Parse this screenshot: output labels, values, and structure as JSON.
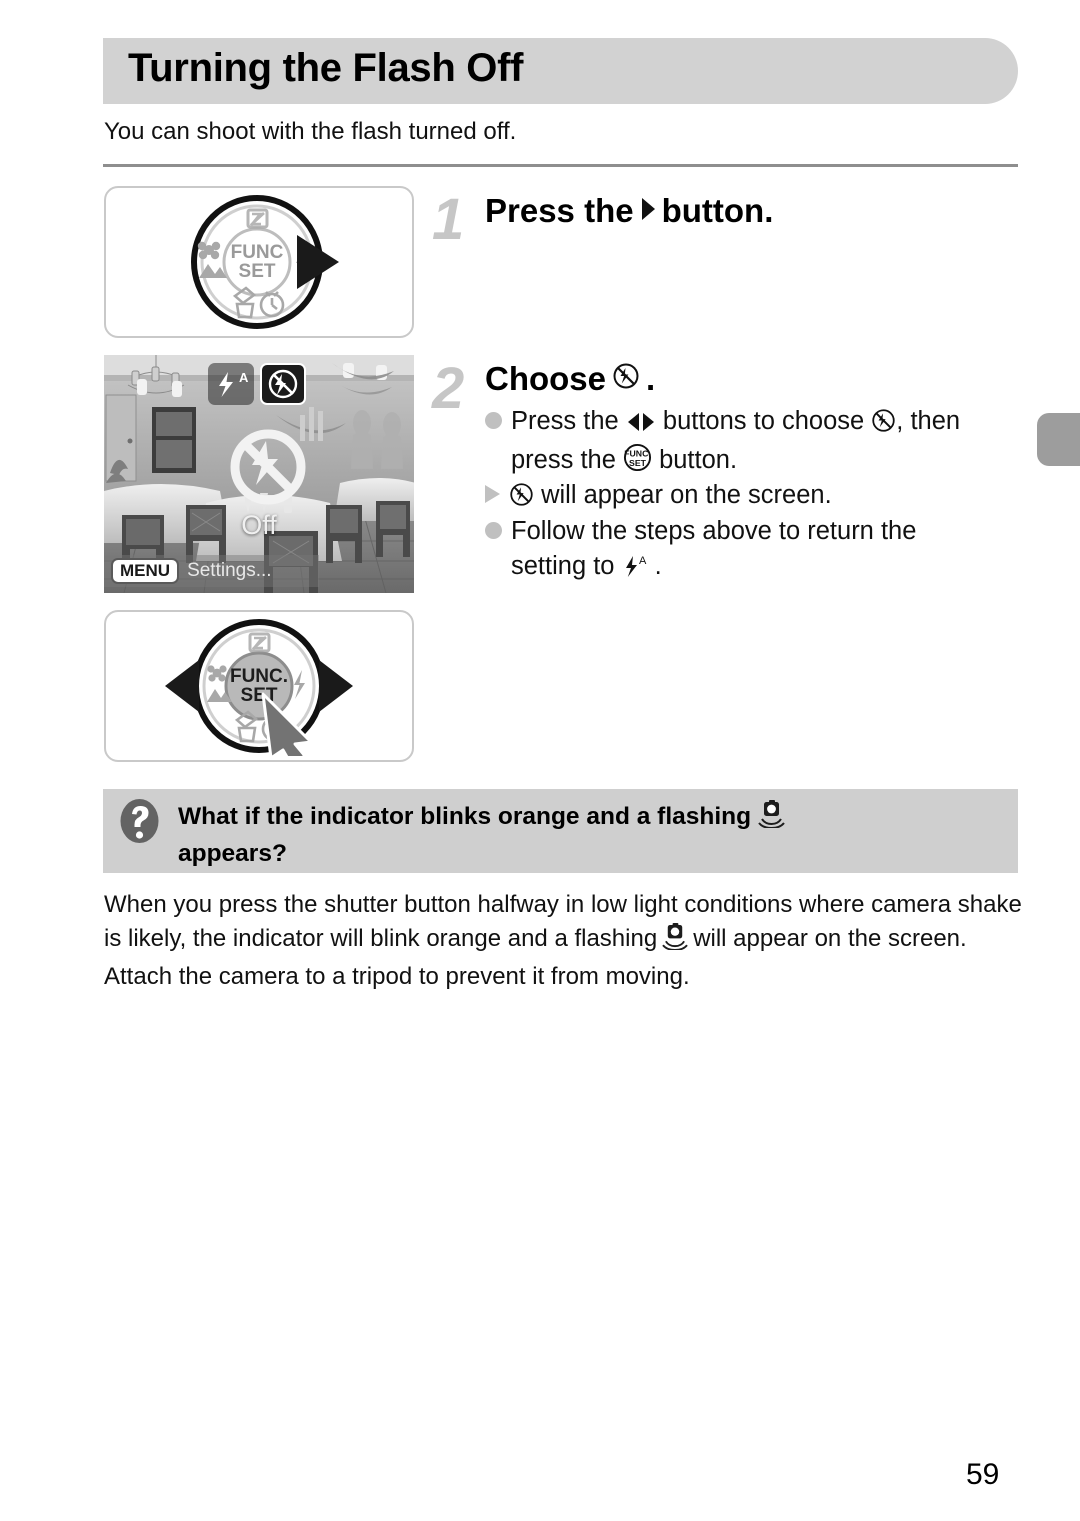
{
  "page": {
    "title": "Turning the Flash Off",
    "intro": "You can shoot with the flash turned off.",
    "number": "59"
  },
  "steps": [
    {
      "number": "1",
      "title_before": "Press the",
      "title_icon": "right-arrow-button-icon",
      "title_after": "button.",
      "figure": {
        "type": "control-dial",
        "center_label_line1": "FUNC",
        "center_label_line2": "SET",
        "highlight": "right-arrow",
        "icons": {
          "top": "exposure-compensation-icon",
          "left": "macro-landscape-icon",
          "right": "flash-icon",
          "bottom": "delete-timer-icon"
        }
      }
    },
    {
      "number": "2",
      "title_before": "Choose",
      "title_icon": "flash-off-icon",
      "title_after": ".",
      "bullets": [
        {
          "marker": "dot",
          "segments": [
            {
              "text": "Press the "
            },
            {
              "icon": "left-right-arrows-icon"
            },
            {
              "text": " buttons to choose "
            },
            {
              "icon": "flash-off-icon"
            },
            {
              "text": ", then press the "
            },
            {
              "icon": "func-set-button-icon"
            },
            {
              "text": " button."
            }
          ]
        },
        {
          "marker": "triangle",
          "segments": [
            {
              "icon": "flash-off-icon"
            },
            {
              "text": " will appear on the screen."
            }
          ]
        },
        {
          "marker": "dot",
          "segments": [
            {
              "text": "Follow the steps above to return the setting to "
            },
            {
              "icon": "flash-auto-icon"
            },
            {
              "text": " ."
            }
          ]
        }
      ],
      "figure": {
        "type": "control-dial-pressed",
        "center_label_line1": "FUNC",
        "center_label_line2": "SET",
        "highlight": "left-right-arrows-and-center-press"
      }
    }
  ],
  "lcd_screen": {
    "scene_description": "restaurant-interior-photo",
    "flash_options": [
      {
        "name": "flash-auto",
        "label": "",
        "selected": false
      },
      {
        "name": "flash-off",
        "label": "",
        "selected": true
      }
    ],
    "selected_mode_label": "Off",
    "menu_badge": "MENU",
    "menu_hint": "Settings..."
  },
  "qa": {
    "icon": "question-mark-icon",
    "heading_before": "What if the indicator blinks orange and a flashing",
    "heading_icon": "camera-shake-icon",
    "heading_after": "appears?",
    "body_part1": "When you press the shutter button halfway in low light conditions where camera shake is likely, the indicator will blink orange and a flashing",
    "body_icon": "camera-shake-icon",
    "body_part2": "will appear on the screen. Attach the camera to a tripod to prevent it from moving."
  },
  "colors": {
    "banner_gray": "#d2d2d2",
    "qa_panel_gray": "#cfcfcf",
    "bullet_gray": "#c0c0c0",
    "step_number_gray": "#c6c6c6",
    "rule_gray": "#8e8e8e",
    "edge_tab_gray": "#9d9d9d"
  }
}
